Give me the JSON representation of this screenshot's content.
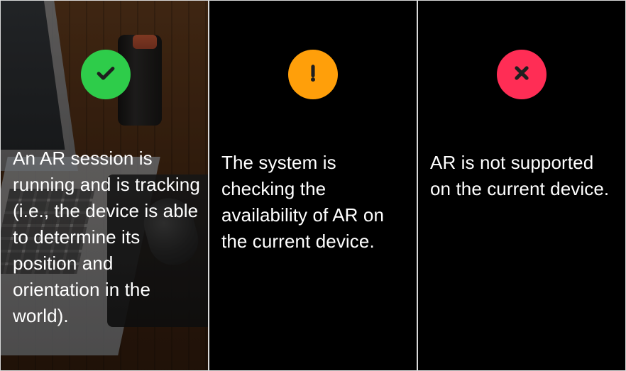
{
  "panels": [
    {
      "status": "success",
      "status_color": "#2ecc4a",
      "icon": "checkmark-icon",
      "caption": "An AR session is running and is tracking (i.e., the device is able to determine its position and orientation in the world).",
      "background": "photo"
    },
    {
      "status": "warning",
      "status_color": "#ff9f0a",
      "icon": "exclamation-icon",
      "caption": "The system is checking the availability of AR on the current device.",
      "background": "black"
    },
    {
      "status": "error",
      "status_color": "#ff2d55",
      "icon": "close-icon",
      "caption": "AR is not supported on the current device.",
      "background": "black"
    }
  ],
  "colors": {
    "text": "#ffffff",
    "divider": "#d9d9d9",
    "panel_bg": "#000000"
  }
}
